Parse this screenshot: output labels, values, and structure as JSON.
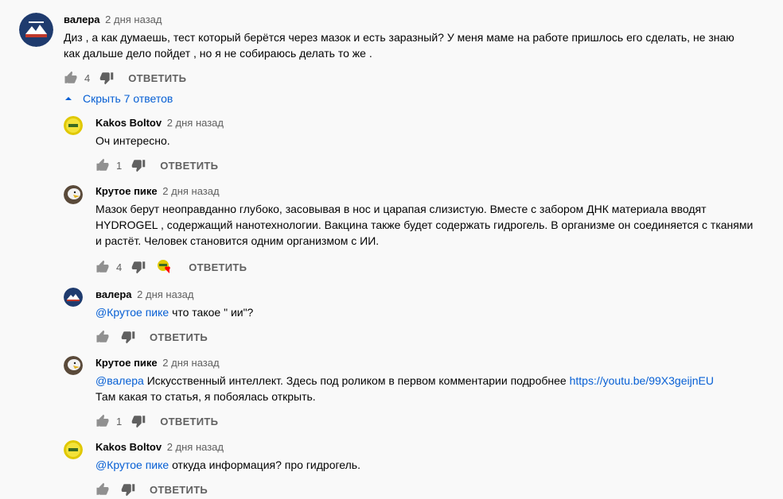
{
  "thread": {
    "author": "валера",
    "time": "2 дня назад",
    "text": [
      "Диз , а как думаешь,  тест который берётся через мазок и есть заразный? У меня маме на работе пришлось его сделать,  не знаю",
      "как дальше дело пойдет , но я не собираюсь  делать то же ."
    ],
    "likes": "4",
    "reply_label": "ОТВЕТИТЬ",
    "toggle_label": "Скрыть 7 ответов"
  },
  "replies": [
    {
      "author": "Kakos Boltov",
      "time": "2 дня назад",
      "text": [
        "Оч интересно."
      ],
      "likes": "1"
    },
    {
      "author": "Крутое пике",
      "time": "2 дня назад",
      "text": [
        "Мазок берут неоправданно глубоко, засовывая в нос и царапая слизистую. Вместе с забором ДНК материала вводят",
        "HYDROGEL , содержащий нанотехнологии. Вакцина также будет содержать гидрогель. В организме он соединяется с тканями",
        "и растёт. Человек становится одним организмом с ИИ."
      ],
      "likes": "4"
    },
    {
      "author": "валера",
      "time": "2 дня назад",
      "mention": "@Крутое пике",
      "text_after_mention": " что такое \" ии\"?",
      "likes": ""
    },
    {
      "author": "Крутое пике",
      "time": "2 дня назад",
      "mention": "@валера",
      "text_after_mention": " Искусственный интеллект.  Здесь под роликом в первом комментарии подробнее  ",
      "link": "https://youtu.be/99X3geijnEU",
      "text_line2": "Там какая то статья, я побоялась открыть.",
      "likes": "1"
    },
    {
      "author": "Kakos Boltov",
      "time": "2 дня назад",
      "mention": "@Крутое пике",
      "text_after_mention": " откуда информация? про гидрогель.",
      "likes": ""
    }
  ],
  "reply_label": "ОТВЕТИТЬ",
  "colors": {
    "link": "#065fd4",
    "muted": "#606060",
    "heart": "#ff0000"
  }
}
